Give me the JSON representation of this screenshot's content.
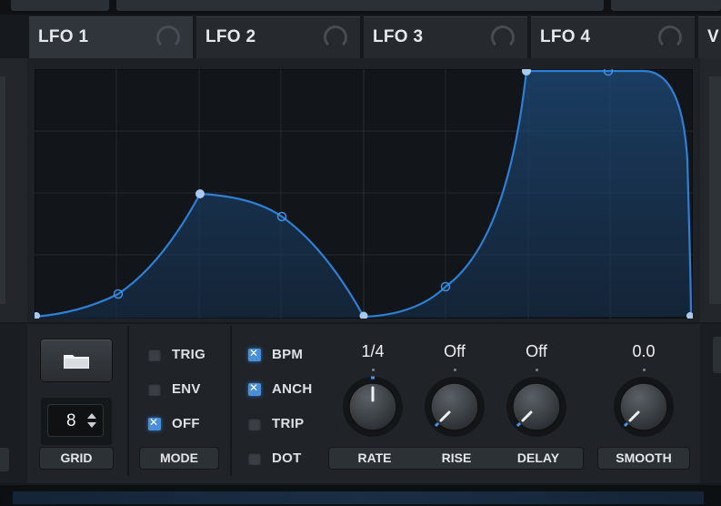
{
  "tabs": [
    {
      "label": "LFO 1",
      "active": true
    },
    {
      "label": "LFO 2",
      "active": false
    },
    {
      "label": "LFO 3",
      "active": false
    },
    {
      "label": "LFO 4",
      "active": false
    }
  ],
  "next_tab_partial": "V",
  "grid": {
    "value": "8",
    "label": "GRID"
  },
  "mode": {
    "label": "MODE",
    "options": [
      {
        "label": "TRIG",
        "checked": false
      },
      {
        "label": "ENV",
        "checked": false
      },
      {
        "label": "OFF",
        "checked": true
      }
    ]
  },
  "timing": {
    "options": [
      {
        "label": "BPM",
        "checked": true
      },
      {
        "label": "ANCH",
        "checked": true
      },
      {
        "label": "TRIP",
        "checked": false
      },
      {
        "label": "DOT",
        "checked": false
      }
    ]
  },
  "knobs": [
    {
      "label": "RATE",
      "value": "1/4"
    },
    {
      "label": "RISE",
      "value": "Off"
    },
    {
      "label": "DELAY",
      "value": "Off"
    },
    {
      "label": "SMOOTH",
      "value": "0.0"
    }
  ],
  "colors": {
    "accent": "#3f8fe0",
    "curve": "#2f7fd4",
    "panel": "#202429"
  }
}
